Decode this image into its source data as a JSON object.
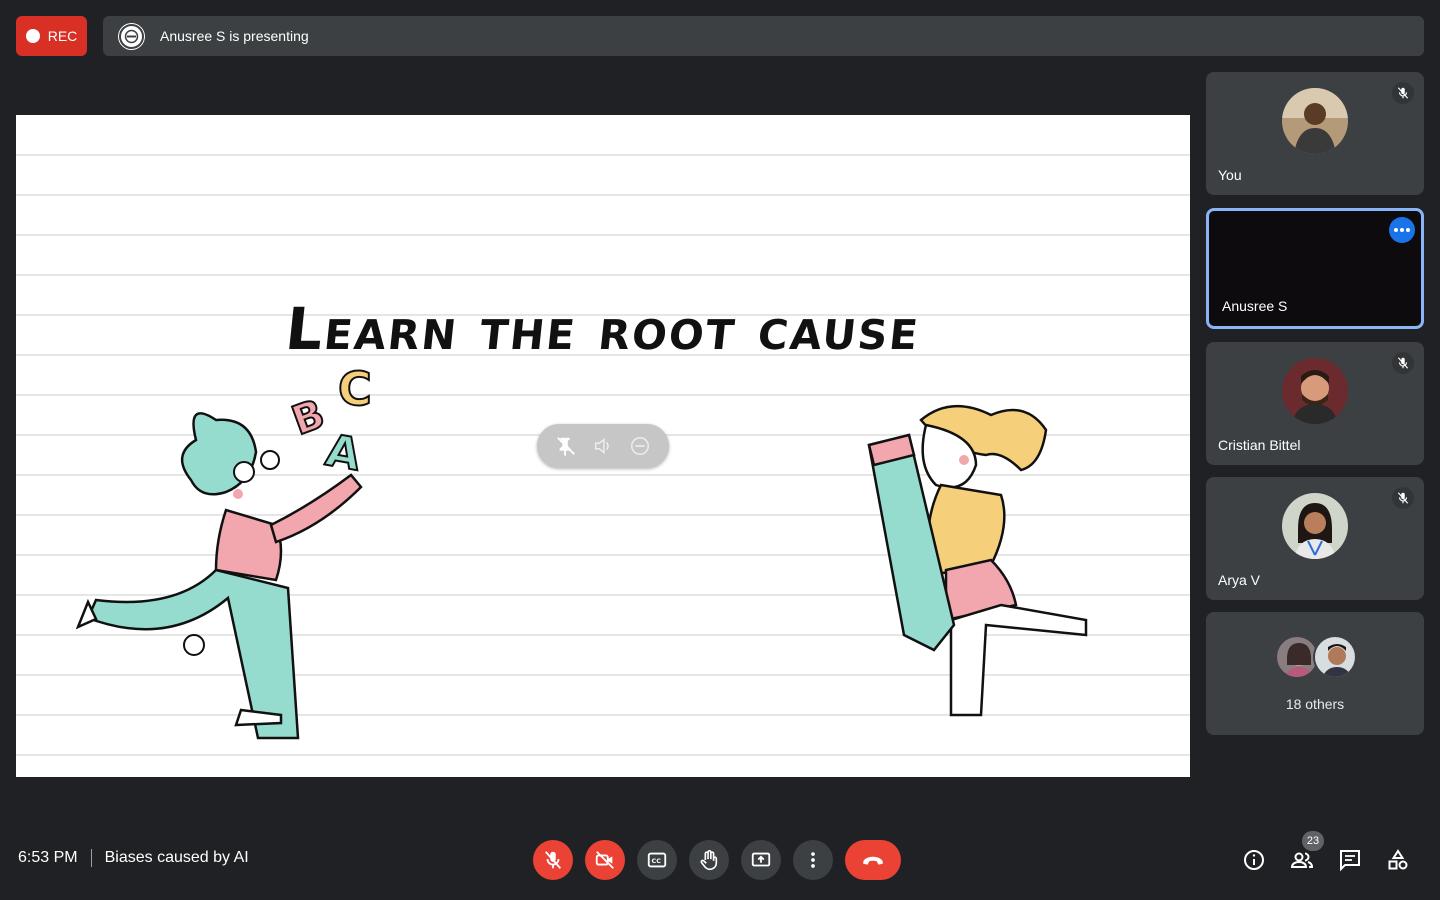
{
  "top_bar": {
    "rec_label": "REC",
    "presenting_text": "Anusree S is presenting"
  },
  "slide": {
    "title": "Learn the root cause"
  },
  "participants": [
    {
      "name": "You",
      "muted": true
    },
    {
      "name": "Anusree S",
      "muted": false,
      "active_speaker": true
    },
    {
      "name": "Cristian Bittel",
      "muted": true
    },
    {
      "name": "Arya V",
      "muted": true
    }
  ],
  "others": {
    "label": "18 others"
  },
  "bottom_bar": {
    "time": "6:53 PM",
    "meeting_title": "Biases caused by AI",
    "participant_count": "23"
  },
  "icons": {
    "mic_off": "mic-off-icon",
    "camera_off": "camera-off-icon",
    "captions": "captions-icon",
    "raise_hand": "raise-hand-icon",
    "present": "present-screen-icon",
    "more": "more-vert-icon",
    "hangup": "hangup-icon",
    "info": "info-icon",
    "people": "people-icon",
    "chat": "chat-icon",
    "activities": "activities-icon"
  },
  "colors": {
    "background": "#202124",
    "tile": "#3c4043",
    "danger": "#ea4335",
    "rec": "#d93025",
    "accent": "#8ab4f8",
    "more_button": "#1a73e8"
  }
}
